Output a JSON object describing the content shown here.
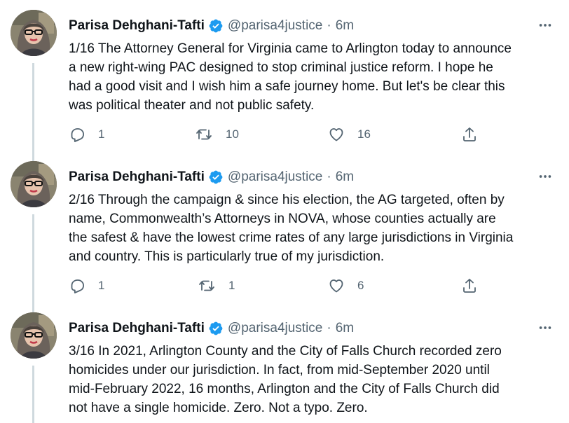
{
  "tweets": [
    {
      "author": "Parisa Dehghani-Tafti",
      "handle": "@parisa4justice",
      "separator": "·",
      "time": "6m",
      "text": "1/16 The Attorney General for Virginia came to Arlington today to announce\na new right-wing PAC designed to stop criminal justice reform. I hope he\nhad a good visit and I wish him a safe journey home. But let's be clear this\nwas political theater and not public safety.",
      "replies": "1",
      "retweets": "10",
      "likes": "16"
    },
    {
      "author": "Parisa Dehghani-Tafti",
      "handle": "@parisa4justice",
      "separator": "·",
      "time": "6m",
      "text": "2/16 Through the campaign & since his election, the AG targeted, often by\nname, Commonwealth’s Attorneys in NOVA, whose counties actually are\nthe safest & have the lowest crime rates of any large jurisdictions in Virginia\nand country. This is particularly true of my jurisdiction.",
      "replies": "1",
      "retweets": "1",
      "likes": "6"
    },
    {
      "author": "Parisa Dehghani-Tafti",
      "handle": "@parisa4justice",
      "separator": "·",
      "time": "6m",
      "text": "3/16 In 2021, Arlington County and the City of Falls Church recorded zero\nhomicides under our jurisdiction. In fact, from mid-September 2020 until\nmid-February 2022, 16 months, Arlington and the City of Falls Church did\nnot have a single homicide. Zero. Not a typo. Zero."
    }
  ],
  "icons": {
    "verified": "verified-badge-icon",
    "more": "more-icon",
    "reply": "reply-icon",
    "retweet": "retweet-icon",
    "like": "like-icon",
    "share": "share-icon"
  },
  "colors": {
    "verified_blue": "#1d9bf0",
    "text": "#0f1419",
    "secondary": "#536471",
    "thread_line": "#cfd9de"
  }
}
